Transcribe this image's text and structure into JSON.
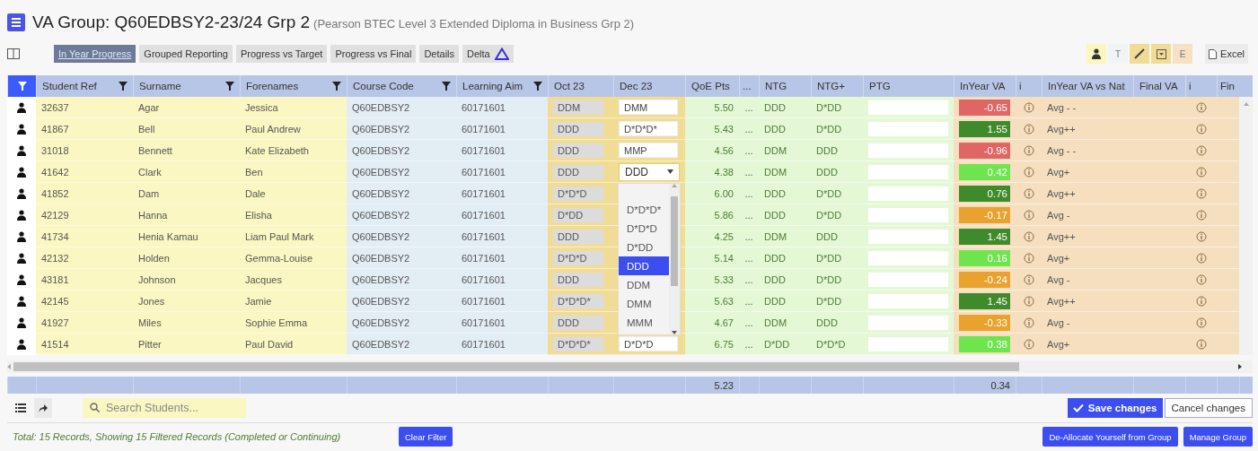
{
  "header": {
    "title": "VA Group: Q60EDBSY2-23/24 Grp 2",
    "subtitle": "(Pearson BTEC Level 3 Extended Diploma in Business Grp 2)"
  },
  "tabs": [
    {
      "label": "In Year Progress",
      "selected": true
    },
    {
      "label": "Grouped Reporting",
      "selected": false
    },
    {
      "label": "Progress vs Target",
      "selected": false
    },
    {
      "label": "Progress vs Final",
      "selected": false
    },
    {
      "label": "Details",
      "selected": false
    },
    {
      "label": "Delta",
      "selected": false,
      "kind": "delta"
    }
  ],
  "column_group_buttons": [
    {
      "kind": "person"
    },
    {
      "kind": "text",
      "label": "T"
    },
    {
      "kind": "pencil"
    },
    {
      "kind": "dropdown"
    },
    {
      "kind": "text",
      "label": "E"
    }
  ],
  "excel_button": "Excel",
  "table": {
    "columns": [
      {
        "label": "Student Ref",
        "filter": true
      },
      {
        "label": "Surname",
        "filter": true
      },
      {
        "label": "Forenames",
        "filter": true
      },
      {
        "label": "Course Code",
        "filter": true
      },
      {
        "label": "Learning Aim",
        "filter": true
      },
      {
        "label": "Oct 23",
        "filter": false
      },
      {
        "label": "Dec 23",
        "filter": false
      },
      {
        "label": "QoE Pts",
        "filter": false
      },
      {
        "label": "...",
        "filter": false
      },
      {
        "label": "NTG",
        "filter": false
      },
      {
        "label": "NTG+",
        "filter": false
      },
      {
        "label": "PTG",
        "filter": false
      },
      {
        "label": "InYear VA",
        "filter": false
      },
      {
        "label": "i",
        "filter": false
      },
      {
        "label": "InYear VA vs Nat",
        "filter": false
      },
      {
        "label": "Final VA",
        "filter": false
      },
      {
        "label": "i",
        "filter": false
      },
      {
        "label": "Fin",
        "filter": false
      }
    ],
    "rows": [
      {
        "student_ref": "32637",
        "surname": "Agar",
        "forenames": "Jessica",
        "course_code": "Q60EDBSY2",
        "learning_aim": "60171601",
        "oct_23": "DDM",
        "dec_23": {
          "kind": "input",
          "value": "DMM"
        },
        "qoe_pts": "5.50",
        "more": "...",
        "ntg": "DDD",
        "ntg_plus": "D*DD",
        "inyear_va": {
          "value": "-0.65",
          "color": "#e06666"
        },
        "va_vs_nat": "Avg - -"
      },
      {
        "student_ref": "41867",
        "surname": "Bell",
        "forenames": "Paul Andrew",
        "course_code": "Q60EDBSY2",
        "learning_aim": "60171601",
        "oct_23": "DDD",
        "dec_23": {
          "kind": "input",
          "value": "D*D*D*"
        },
        "qoe_pts": "5.43",
        "more": "...",
        "ntg": "DDD",
        "ntg_plus": "D*DD",
        "inyear_va": {
          "value": "1.55",
          "color": "#3f8a2b"
        },
        "va_vs_nat": "Avg++"
      },
      {
        "student_ref": "31018",
        "surname": "Bennett",
        "forenames": "Kate Elizabeth",
        "course_code": "Q60EDBSY2",
        "learning_aim": "60171601",
        "oct_23": "DDD",
        "dec_23": {
          "kind": "input",
          "value": "MMP"
        },
        "qoe_pts": "4.56",
        "more": "...",
        "ntg": "DDM",
        "ntg_plus": "DDD",
        "inyear_va": {
          "value": "-0.96",
          "color": "#e06666"
        },
        "va_vs_nat": "Avg - -"
      },
      {
        "student_ref": "41642",
        "surname": "Clark",
        "forenames": "Ben",
        "course_code": "Q60EDBSY2",
        "learning_aim": "60171601",
        "oct_23": "DDD",
        "dec_23": {
          "kind": "select",
          "value": "DDD",
          "expanded": true
        },
        "qoe_pts": "4.38",
        "more": "...",
        "ntg": "DDM",
        "ntg_plus": "DDD",
        "inyear_va": {
          "value": "0.42",
          "color": "#6ee54f"
        },
        "va_vs_nat": "Avg+"
      },
      {
        "student_ref": "41852",
        "surname": "Dam",
        "forenames": "Dale",
        "course_code": "Q60EDBSY2",
        "learning_aim": "60171601",
        "oct_23": "D*D*D",
        "qoe_pts": "6.00",
        "more": "...",
        "ntg": "DDD",
        "ntg_plus": "D*DD",
        "inyear_va": {
          "value": "0.76",
          "color": "#3f8a2b"
        },
        "va_vs_nat": "Avg++"
      },
      {
        "student_ref": "42129",
        "surname": "Hanna",
        "forenames": "Elisha",
        "course_code": "Q60EDBSY2",
        "learning_aim": "60171601",
        "oct_23": "D*DD",
        "qoe_pts": "5.86",
        "more": "...",
        "ntg": "DDD",
        "ntg_plus": "D*DD",
        "inyear_va": {
          "value": "-0.17",
          "color": "#e8a22d"
        },
        "va_vs_nat": "Avg -"
      },
      {
        "student_ref": "41734",
        "surname": "Henia Kamau",
        "forenames": "Liam Paul Mark",
        "course_code": "Q60EDBSY2",
        "learning_aim": "60171601",
        "oct_23": "DDD",
        "qoe_pts": "4.25",
        "more": "...",
        "ntg": "DDM",
        "ntg_plus": "DDD",
        "inyear_va": {
          "value": "1.45",
          "color": "#3f8a2b"
        },
        "va_vs_nat": "Avg++"
      },
      {
        "student_ref": "42132",
        "surname": "Holden",
        "forenames": "Gemma-Louise",
        "course_code": "Q60EDBSY2",
        "learning_aim": "60171601",
        "oct_23": "D*D*D",
        "qoe_pts": "5.14",
        "more": "...",
        "ntg": "DDD",
        "ntg_plus": "D*DD",
        "inyear_va": {
          "value": "0.16",
          "color": "#6ee54f"
        },
        "va_vs_nat": "Avg+"
      },
      {
        "student_ref": "43181",
        "surname": "Johnson",
        "forenames": "Jacques",
        "course_code": "Q60EDBSY2",
        "learning_aim": "60171601",
        "oct_23": "DDD",
        "qoe_pts": "5.33",
        "more": "...",
        "ntg": "DDD",
        "ntg_plus": "D*DD",
        "inyear_va": {
          "value": "-0.24",
          "color": "#e8a22d"
        },
        "va_vs_nat": "Avg -"
      },
      {
        "student_ref": "42145",
        "surname": "Jones",
        "forenames": "Jamie",
        "course_code": "Q60EDBSY2",
        "learning_aim": "60171601",
        "oct_23": "D*D*D*",
        "qoe_pts": "5.63",
        "more": "...",
        "ntg": "DDD",
        "ntg_plus": "D*DD",
        "inyear_va": {
          "value": "1.45",
          "color": "#3f8a2b"
        },
        "va_vs_nat": "Avg++"
      },
      {
        "student_ref": "41927",
        "surname": "Miles",
        "forenames": "Sophie Emma",
        "course_code": "Q60EDBSY2",
        "learning_aim": "60171601",
        "oct_23": "DDD",
        "qoe_pts": "4.67",
        "more": "...",
        "ntg": "DDM",
        "ntg_plus": "DDD",
        "inyear_va": {
          "value": "-0.33",
          "color": "#e8a22d"
        },
        "va_vs_nat": "Avg -"
      },
      {
        "student_ref": "41514",
        "surname": "Pitter",
        "forenames": "Paul David",
        "course_code": "Q60EDBSY2",
        "learning_aim": "60171601",
        "oct_23": "D*D*D*",
        "dec_23": {
          "kind": "input",
          "value": "D*D*D"
        },
        "qoe_pts": "6.75",
        "more": "...",
        "ntg": "D*DD",
        "ntg_plus": "D*D*D",
        "inyear_va": {
          "value": "0.38",
          "color": "#6ee54f"
        },
        "va_vs_nat": "Avg+"
      }
    ],
    "totals": {
      "qoe_pts": "5.23",
      "inyear_va": "0.34"
    }
  },
  "dropdown": {
    "options": [
      {
        "label": "D*D*D*",
        "selected": false
      },
      {
        "label": "D*D*D",
        "selected": false
      },
      {
        "label": "D*DD",
        "selected": false
      },
      {
        "label": "DDD",
        "selected": true
      },
      {
        "label": "DDM",
        "selected": false
      },
      {
        "label": "DMM",
        "selected": false
      },
      {
        "label": "MMM",
        "selected": false
      }
    ]
  },
  "search": {
    "placeholder": "Search Students..."
  },
  "save_button": "Save changes",
  "cancel_button": "Cancel changes",
  "status": "Total: 15 Records, Showing 15 Filtered Records (Completed or Continuing)",
  "clear_filter_button": "Clear Filter",
  "deallocate_button": "De-Allocate Yourself from Group",
  "manage_group_button": "Manage Group"
}
